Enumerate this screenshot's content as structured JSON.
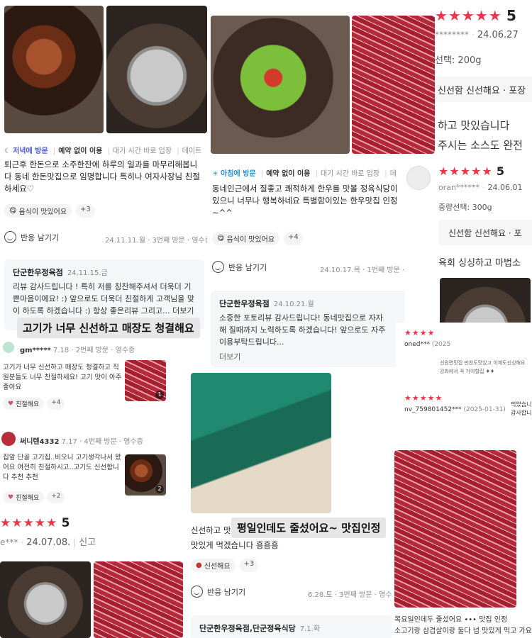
{
  "colors": {
    "accent": "#e8364a",
    "chip_bg": "#f4f4f4",
    "owner_bg": "#f5f6f8"
  },
  "card1": {
    "visit_time": "저녁에 방문",
    "tags": [
      "예약 없이 이용",
      "대기 시간 바로 입장",
      "데이트"
    ],
    "text": "퇴근후 한돈으로 소주한잔에 하루의 일과를 마무리해봅니다 동네 한돈맛집으로 임명합니다 특히나 여자사장님 친절하세요♡",
    "chip": "음식이 맛있어요",
    "more": "+3",
    "react_label": "반응 남기기",
    "date_meta": "24.11.11.월 · 3번째 방문 · 영수증",
    "owner_name": "단군한우정육점",
    "owner_date": "24.11.15.금",
    "owner_text": "리뷰 감사드립니다 ! 특히 저를 칭찬해주셔서 더욱더 기쁜마음이에요! :) 앞으로도 더욱더 친절하게 고객님을 맞이 하도록 하겠습니다 :) 항상 좋은리뷰 그리고... 더보기"
  },
  "card2": {
    "visit_time": "아침에 방문",
    "tags": [
      "예약 없이 이용",
      "대기 시간 바로 입장",
      "데"
    ],
    "text": "동네인근에서 질좋고 쾌적하게 한우를 맛볼 정육식당이 있으니 너무나 행복하네요 특별함이있는 한우맛집 인정~^^",
    "chip": "음식이 맛있어요",
    "more": "+4",
    "react_label": "반응 남기기",
    "date_meta": "24.10.17.목 · 1번째 방문 · 영수증",
    "owner_name": "단군한우정육점",
    "owner_date": "24.10.21.월",
    "owner_text": "소중한 포토리뷰 감사드립니다! 동네맛집으로 자자해 질때까지 노력하도록 하겠습니다! 앞으로도 자주 이용부탁드립니다...",
    "more_link": "더보기"
  },
  "card3": {
    "stars": "★★★★★",
    "rating": "5",
    "user": "********",
    "date": "24.06.27",
    "option": "선택: 200g",
    "keywords": "신선함 신선해요 · 포장",
    "line1": "하고 맛있습니다",
    "line2": "주시는 소스도 완전"
  },
  "card4": {
    "stars": "★★★★★",
    "rating": "5",
    "user": "oran******",
    "date": "24.06.01",
    "option": "중량선택: 300g",
    "keywords": "신선함 신선해요 · 포",
    "line1": "육회 싱싱하고 마법소"
  },
  "banner1": "고기가 너무 신선하고 매장도 청결해요",
  "banner2": "평일인데도 줄섰어요~ 맛집인정",
  "card5": {
    "user": "gm*****",
    "meta": "7.18 · 2번째 방문 · 영수증",
    "text": "고기가 너무 신선하고 매장도 청결하고 직원분들도 너무 친절하세요! 고기 맛이 아주 좋아요",
    "chip": "친절해요",
    "more": "+4",
    "photo_count": "1"
  },
  "card6": {
    "user": "써니텐4332",
    "meta": "7.17 · 4번째 방문 · 영수증",
    "text": "집앞 단골 고기집..비오니 고기생각나서 왔어요 여전히 친절하시고..고기도 신선합니다 추천 추천",
    "chip": "친절해요",
    "more": "+2",
    "photo_count": "2"
  },
  "card7": {
    "stars": "★★★★★",
    "rating": "5",
    "user": "e***",
    "date": "24.07.08.",
    "report": "신고"
  },
  "card8": {
    "text": "신선하고 맛",
    "text2": "맛있게 먹겠습니다 흥흥흥",
    "chip": "신선해요",
    "more": "+3",
    "react_label": "반응 남기기",
    "date_meta": "6.28.토 · 3번째 방문 · 영수",
    "owner_name": "단군한우정육점,단군정육식당",
    "owner_date": "7.1.화"
  },
  "card9": {
    "stars": "★★★★",
    "user": "oned***",
    "date": "(2025",
    "stars2": "★★★★★",
    "user2": "nv_759801452***",
    "date2": "(2025-01-31)",
    "text1": "선원면맛집 반찬도맛있고 이제도신싱해요",
    "text2": "강화에서 꼭 가야할집 ♦♦",
    "side1": "먹었습니",
    "side2": "감사합니"
  },
  "card10": {
    "line1": "목요일인데두 줄섰어요 ••• 맛집 인정",
    "line2": "소고기랑 삼겹살이랑 둘다 넘 맛있게 먹고 가요"
  }
}
